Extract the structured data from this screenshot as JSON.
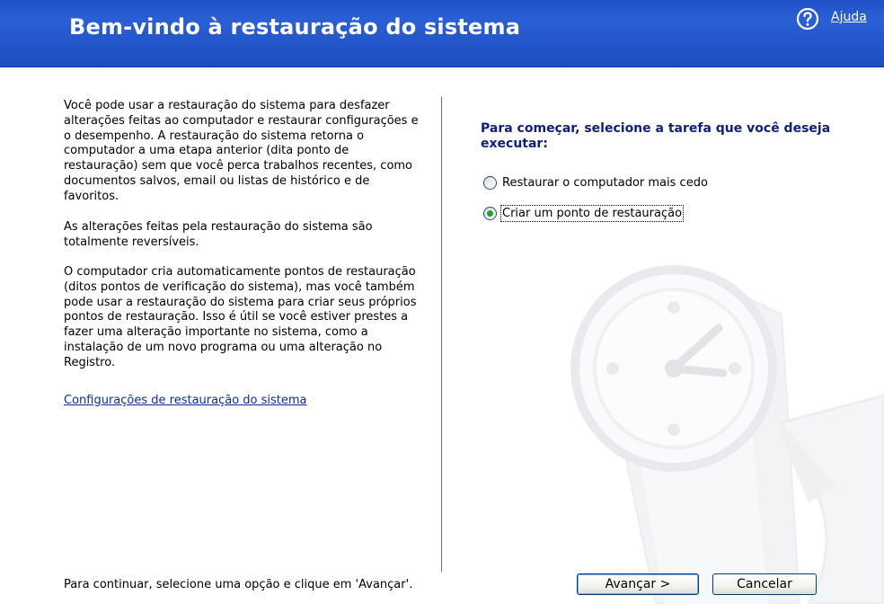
{
  "header": {
    "title": "Bem-vindo à restauração do sistema",
    "help_label": "Ajuda",
    "help_icon": "question-circle-icon"
  },
  "left": {
    "paragraph1": "Você pode usar a restauração do sistema para desfazer alterações feitas ao computador e restaurar configurações e o desempenho. A restauração do sistema retorna o computador a uma etapa anterior (dita ponto de restauração) sem que você perca trabalhos recentes, como documentos salvos, email ou listas de histórico e de favoritos.",
    "paragraph2": "As alterações feitas pela restauração do sistema são totalmente reversíveis.",
    "paragraph3": "O computador cria automaticamente pontos de restauração (ditos pontos de verificação do sistema), mas você também pode usar a restauração do sistema para criar seus próprios pontos de restauração. Isso é útil se você estiver prestes a fazer uma alteração importante no sistema, como a instalação de um novo programa ou uma alteração no Registro.",
    "settings_link": "Configurações de restauração do sistema",
    "footer": "Para continuar, selecione uma opção e clique em 'Avançar'."
  },
  "right": {
    "prompt": "Para começar, selecione a tarefa que você deseja executar:",
    "options": [
      {
        "label": "Restaurar o computador mais cedo",
        "checked": false
      },
      {
        "label": "Criar um ponto de restauração",
        "checked": true
      }
    ]
  },
  "buttons": {
    "next": "Avançar >",
    "cancel": "Cancelar"
  },
  "colors": {
    "header_blue": "#1f52c8",
    "prompt_blue": "#10207a",
    "link_blue": "#0b2d9a",
    "radio_green": "#21a121"
  }
}
